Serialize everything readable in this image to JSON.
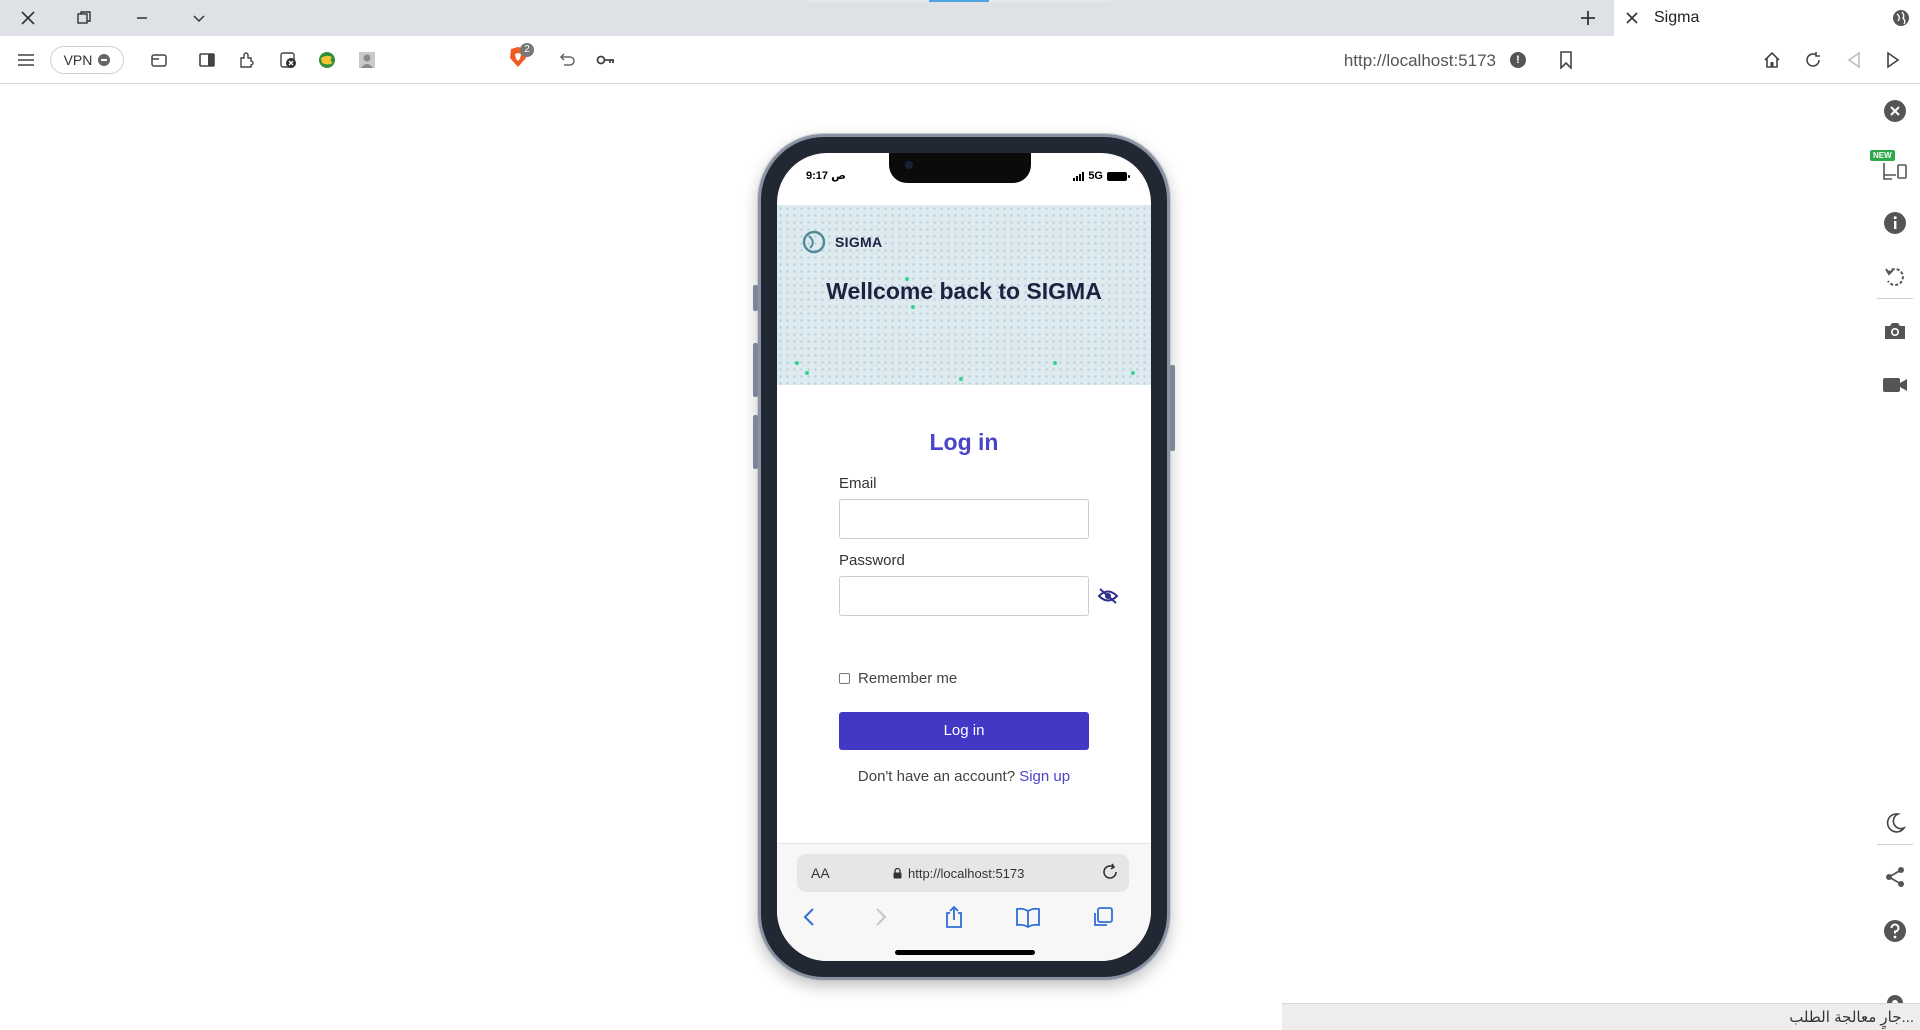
{
  "browser": {
    "tab_title": "Sigma",
    "vpn_label": "VPN",
    "address_url": "http://localhost:5173",
    "brave_badge_count": "2",
    "status_text": "جارٍ معالجة الطلب...",
    "icons": [
      "close-icon",
      "restore-icon",
      "minimize-icon",
      "chevron-down-icon",
      "new-tab-icon",
      "menu-icon",
      "bookmark-icon",
      "home-icon",
      "reload-icon",
      "back-icon",
      "forward-icon"
    ]
  },
  "sidebar": {
    "new_badge": "NEW",
    "icons": [
      "close-icon",
      "responsive-icon",
      "info-icon",
      "rotate-icon",
      "camera-icon",
      "video-icon",
      "moon-icon",
      "share-icon",
      "help-icon"
    ]
  },
  "phone": {
    "status": {
      "time": "9:17 ص",
      "network": "5G"
    },
    "hero": {
      "logo_text": "SIGMA",
      "title": "Wellcome back to SIGMA"
    },
    "form": {
      "title": "Log in",
      "email_label": "Email",
      "email_value": "",
      "password_label": "Password",
      "password_value": "",
      "remember_label": "Remember me",
      "remember_checked": false,
      "submit_label": "Log in",
      "no_account_text": "Don't have an account?",
      "signup_link": "Sign up"
    },
    "safari": {
      "aa_label": "AA",
      "url": "http://localhost:5173"
    }
  },
  "colors": {
    "primary": "#4138c6",
    "heading_accent": "#4a45c7",
    "hero_bg": "#ddeaef",
    "sparkle": "#37d38b",
    "dark_text": "#1b2340"
  }
}
